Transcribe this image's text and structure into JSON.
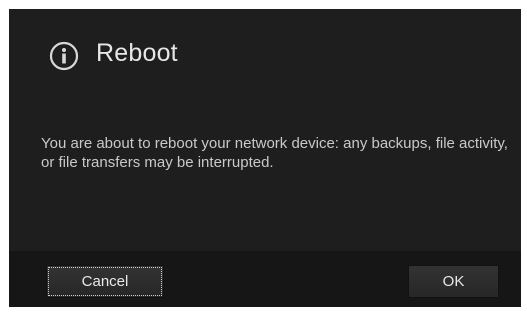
{
  "dialog": {
    "icon": "info-circle-icon",
    "title": "Reboot",
    "message": "You are about to reboot your network device: any backups, file activity, or file transfers may be interrupted.",
    "buttons": {
      "cancel_label": "Cancel",
      "ok_label": "OK"
    },
    "colors": {
      "background": "#1e1e1e",
      "footer": "#161616",
      "text": "#c9c9c9",
      "title": "#e6e6e6"
    }
  }
}
